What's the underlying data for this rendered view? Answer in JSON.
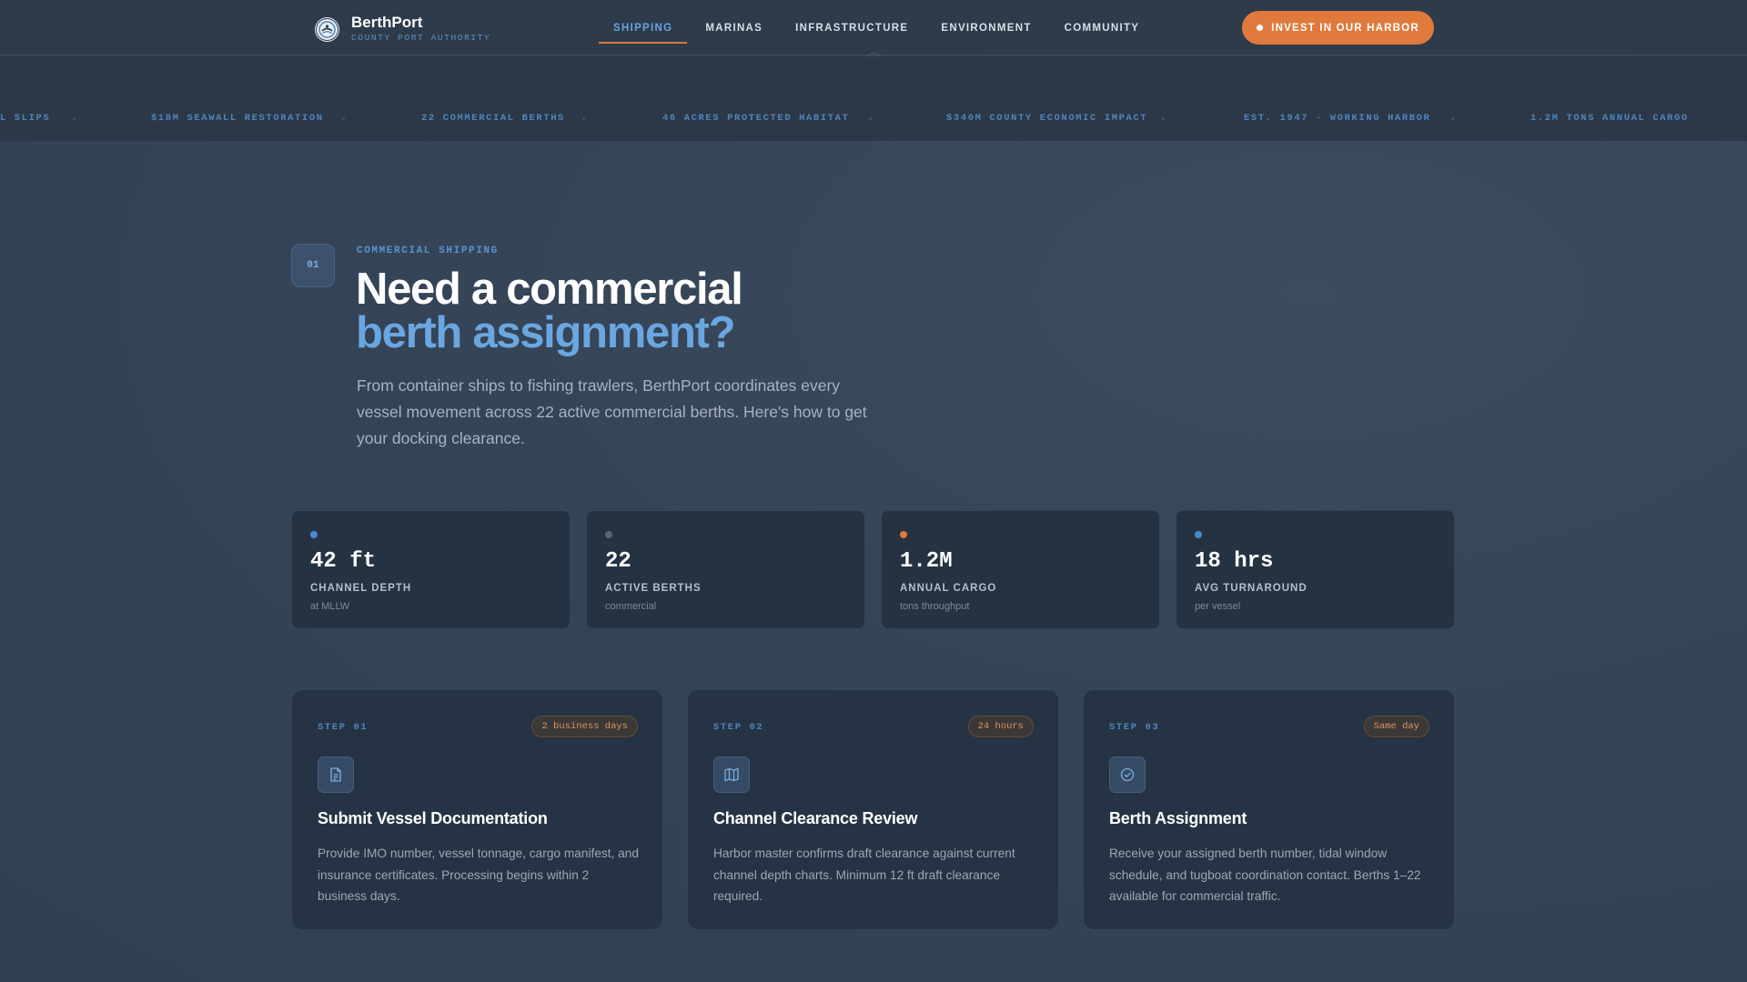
{
  "brand": {
    "name": "BerthPort",
    "subtitle": "COUNTY PORT AUTHORITY",
    "logo_icon": "seal-icon"
  },
  "nav": {
    "links": [
      {
        "label": "SHIPPING",
        "active": true
      },
      {
        "label": "MARINAS",
        "active": false
      },
      {
        "label": "INFRASTRUCTURE",
        "active": false
      },
      {
        "label": "ENVIRONMENT",
        "active": false
      },
      {
        "label": "COMMUNITY",
        "active": false
      }
    ],
    "cta_label": "INVEST IN OUR HARBOR"
  },
  "ticker": {
    "items": [
      "L SLIPS",
      "$18M SEAWALL RESTORATION",
      "22 COMMERCIAL BERTHS",
      "46 ACRES PROTECTED HABITAT",
      "$340M COUNTY ECONOMIC IMPACT",
      "EST. 1947 · WORKING HARBOR",
      "1.2M TONS ANNUAL CARGO"
    ]
  },
  "hero": {
    "step_number": "01",
    "eyebrow": "COMMERCIAL SHIPPING",
    "headline_line1": "Need a commercial",
    "headline_line2": "berth assignment?",
    "lede": "From container ships to fishing trawlers, BerthPort coordinates every vessel movement across 22 active commercial berths. Here's how to get your docking clearance."
  },
  "stats": [
    {
      "value": "42 ft",
      "label": "CHANNEL DEPTH",
      "sub": "at MLLW",
      "dot_color": "#4a8ad4"
    },
    {
      "value": "22",
      "label": "ACTIVE BERTHS",
      "sub": "commercial",
      "dot_color": "#56667a"
    },
    {
      "value": "1.2M",
      "label": "ANNUAL CARGO",
      "sub": "tons throughput",
      "dot_color": "#df7a3c"
    },
    {
      "value": "18 hrs",
      "label": "AVG TURNAROUND",
      "sub": "per vessel",
      "dot_color": "#4a8ad4"
    }
  ],
  "steps": [
    {
      "step": "STEP 01",
      "duration": "2 business days",
      "icon": "document-icon",
      "title": "Submit Vessel Documentation",
      "body": "Provide IMO number, vessel tonnage, cargo manifest, and insurance certificates. Processing begins within 2 business days."
    },
    {
      "step": "STEP 02",
      "duration": "24 hours",
      "icon": "map-icon",
      "title": "Channel Clearance Review",
      "body": "Harbor master confirms draft clearance against current channel depth charts. Minimum 12 ft draft clearance required."
    },
    {
      "step": "STEP 03",
      "duration": "Same day",
      "icon": "check-circle-icon",
      "title": "Berth Assignment",
      "body": "Receive your assigned berth number, tidal window schedule, and tugboat coordination contact. Berths 1–22 available for commercial traffic."
    }
  ],
  "colors": {
    "accent_blue": "#6aa6e0",
    "accent_orange": "#df7a3c",
    "background": "#354457"
  }
}
